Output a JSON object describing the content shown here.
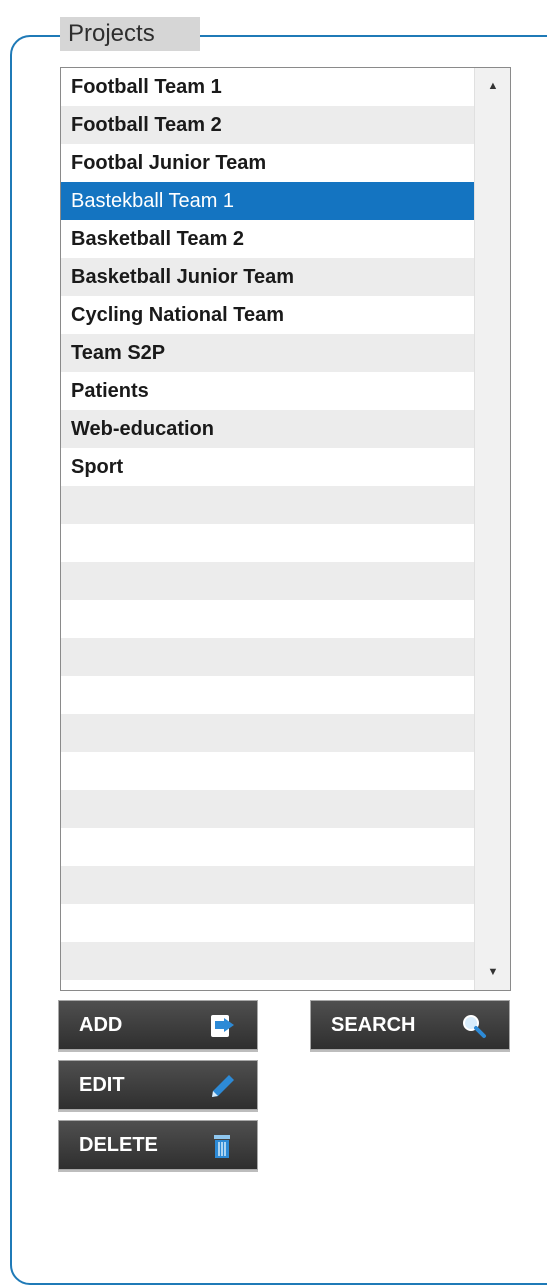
{
  "panel": {
    "title": "Projects"
  },
  "projects": {
    "items": [
      {
        "label": "Football Team 1"
      },
      {
        "label": "Football Team 2"
      },
      {
        "label": "Footbal Junior Team"
      },
      {
        "label": "Bastekball Team 1",
        "selected": true
      },
      {
        "label": "Basketball Team 2"
      },
      {
        "label": "Basketball Junior Team"
      },
      {
        "label": "Cycling National Team"
      },
      {
        "label": "Team S2P"
      },
      {
        "label": "Patients"
      },
      {
        "label": "Web-education"
      },
      {
        "label": "Sport"
      },
      {
        "label": ""
      },
      {
        "label": ""
      },
      {
        "label": ""
      },
      {
        "label": ""
      },
      {
        "label": ""
      },
      {
        "label": ""
      },
      {
        "label": ""
      },
      {
        "label": ""
      },
      {
        "label": ""
      },
      {
        "label": ""
      },
      {
        "label": ""
      },
      {
        "label": ""
      },
      {
        "label": ""
      }
    ]
  },
  "buttons": {
    "add": {
      "label": "ADD",
      "icon": "add-document-icon"
    },
    "search": {
      "label": "SEARCH",
      "icon": "magnifier-icon"
    },
    "edit": {
      "label": "EDIT",
      "icon": "pencil-icon"
    },
    "delete": {
      "label": "DELETE",
      "icon": "trash-icon"
    }
  },
  "colors": {
    "accent": "#1f7ab7",
    "selection": "#1474c1",
    "button": "#3c3c3c",
    "row_alt": "#ececec"
  }
}
